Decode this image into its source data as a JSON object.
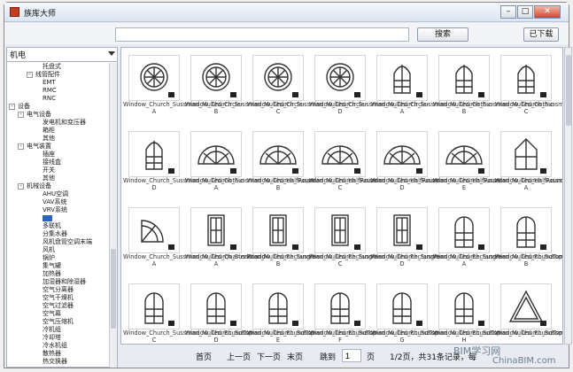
{
  "window": {
    "title": "族库大师"
  },
  "toolbar": {
    "search_value": "",
    "search_button": "搜索",
    "download_button": "已下载"
  },
  "category_combo": {
    "value": "机电"
  },
  "tree": [
    {
      "label": "托盘式",
      "level": 3,
      "toggle": ""
    },
    {
      "label": "线管配件",
      "level": 2,
      "toggle": "-"
    },
    {
      "label": "EMT",
      "level": 3,
      "toggle": ""
    },
    {
      "label": "RMC",
      "level": 3,
      "toggle": ""
    },
    {
      "label": "RNC",
      "level": 3,
      "toggle": ""
    },
    {
      "label": "设备",
      "level": 0,
      "toggle": "-"
    },
    {
      "label": "电气设备",
      "level": 1,
      "toggle": "-"
    },
    {
      "label": "发电机和变压器",
      "level": 3,
      "toggle": ""
    },
    {
      "label": "箱柜",
      "level": 3,
      "toggle": ""
    },
    {
      "label": "其他",
      "level": 3,
      "toggle": ""
    },
    {
      "label": "电气装置",
      "level": 1,
      "toggle": "-"
    },
    {
      "label": "插座",
      "level": 3,
      "toggle": ""
    },
    {
      "label": "接线盒",
      "level": 3,
      "toggle": ""
    },
    {
      "label": "开关",
      "level": 3,
      "toggle": ""
    },
    {
      "label": "其他",
      "level": 3,
      "toggle": ""
    },
    {
      "label": "机械设备",
      "level": 1,
      "toggle": "-"
    },
    {
      "label": "AHU空调",
      "level": 3,
      "toggle": ""
    },
    {
      "label": "VAV系统",
      "level": 3,
      "toggle": ""
    },
    {
      "label": "VRV系统",
      "level": 3,
      "toggle": ""
    },
    {
      "label": "",
      "level": 3,
      "toggle": "",
      "selected": true
    },
    {
      "label": "多联机",
      "level": 3,
      "toggle": ""
    },
    {
      "label": "分集水器",
      "level": 3,
      "toggle": ""
    },
    {
      "label": "风机盘管空调末端",
      "level": 3,
      "toggle": ""
    },
    {
      "label": "风机",
      "level": 3,
      "toggle": ""
    },
    {
      "label": "锅炉",
      "level": 3,
      "toggle": ""
    },
    {
      "label": "集气罐",
      "level": 3,
      "toggle": ""
    },
    {
      "label": "加热器",
      "level": 3,
      "toggle": ""
    },
    {
      "label": "加湿器和除湿器",
      "level": 3,
      "toggle": ""
    },
    {
      "label": "空气分离器",
      "level": 3,
      "toggle": ""
    },
    {
      "label": "空气干燥机",
      "level": 3,
      "toggle": ""
    },
    {
      "label": "空气过滤器",
      "level": 3,
      "toggle": ""
    },
    {
      "label": "空气幕",
      "level": 3,
      "toggle": ""
    },
    {
      "label": "空气压缩机",
      "level": 3,
      "toggle": ""
    },
    {
      "label": "冷机组",
      "level": 3,
      "toggle": ""
    },
    {
      "label": "冷却塔",
      "level": 3,
      "toggle": ""
    },
    {
      "label": "冷水机组",
      "level": 3,
      "toggle": ""
    },
    {
      "label": "散热器",
      "level": 3,
      "toggle": ""
    },
    {
      "label": "热交换器",
      "level": 3,
      "toggle": ""
    }
  ],
  "families": [
    {
      "name": "Window_Church_Sussman_Mulled_Circle-A",
      "icon": "circle-window-icon"
    },
    {
      "name": "Window_Church_Sussman_Mulled_Circle-B",
      "icon": "circle-window-icon"
    },
    {
      "name": "Window_Church_Sussman_Mulled_Circle-C",
      "icon": "circle-window-icon"
    },
    {
      "name": "Window_Church_Sussman_Mulled_Circle-D",
      "icon": "circle-window-icon"
    },
    {
      "name": "Window_Church_Sussman_Mulled_Gothic-A",
      "icon": "gothic-window-icon"
    },
    {
      "name": "Window_Church_Sussman_Mulled_Gothic-B",
      "icon": "gothic-window-icon"
    },
    {
      "name": "Window_Church_Sussman_Mulled_Gothic-C",
      "icon": "gothic-window-icon"
    },
    {
      "name": "Window_Church_Sussman_Mulled_Gothic-D",
      "icon": "gothic-window-icon"
    },
    {
      "name": "Window_Church_Sussman_Mulled_HalfRound-A",
      "icon": "halfround-window-icon"
    },
    {
      "name": "Window_Church_Sussman_Mulled_HalfRound-B",
      "icon": "halfround-window-icon"
    },
    {
      "name": "Window_Church_Sussman_Mulled_HalfRound-C",
      "icon": "halfround-window-icon"
    },
    {
      "name": "Window_Church_Sussman_Mulled_HalfRound-D",
      "icon": "halfround-window-icon"
    },
    {
      "name": "Window_Church_Sussman_Mulled_HalfRound-E",
      "icon": "halfround-window-icon"
    },
    {
      "name": "Window_Church_Sussman_Mulled_Peak-A",
      "icon": "peak-window-icon"
    },
    {
      "name": "Window_Church_Sussman_Mulled_QuarterRound-A",
      "icon": "quarterround-window-icon"
    },
    {
      "name": "Window_Church_Sussman_Mulled_Rectangle-A",
      "icon": "rectangle-window-icon"
    },
    {
      "name": "Window_Church_Sussman_Mulled_Rectangle-B",
      "icon": "rectangle-window-icon"
    },
    {
      "name": "Window_Church_Sussman_Mulled_Rectangle-C",
      "icon": "rectangle-window-icon"
    },
    {
      "name": "Window_Church_Sussman_Mulled_Rectangle-D",
      "icon": "rectangle-window-icon"
    },
    {
      "name": "Window_Church_Sussman_Mulled_RoundTop-A",
      "icon": "roundtop-window-icon"
    },
    {
      "name": "Window_Church_Sussman_Mulled_RoundTop-B",
      "icon": "roundtop-window-icon"
    },
    {
      "name": "Window_Church_Sussman_Mulled_RoundTop-C",
      "icon": "roundtop-window-icon"
    },
    {
      "name": "Window_Church_Sussman_Mulled_RoundTop-D",
      "icon": "roundtop-window-icon"
    },
    {
      "name": "Window_Church_Sussman_Mulled_RoundTop-E",
      "icon": "roundtop-window-icon"
    },
    {
      "name": "Window_Church_Sussman_Mulled_RoundTop-F",
      "icon": "roundtop-window-icon"
    },
    {
      "name": "Window_Church_Sussman_Mulled_RoundTop-G",
      "icon": "roundtop-window-icon"
    },
    {
      "name": "Window_Church_Sussman_Mulled_RoundTop-H",
      "icon": "roundtop-window-icon"
    },
    {
      "name": "Window_Church_Sussman_Trian",
      "icon": "triangle-window-icon"
    }
  ],
  "pager": {
    "first": "首页",
    "prev": "上一页",
    "next": "下一页",
    "last": "末页",
    "jump": "跳到",
    "page_value": "1",
    "page_unit": "页",
    "summary": "1/2页，共31条记录，每"
  },
  "watermark": {
    "line1": "BIM学习网",
    "line2": "ChinaBIM.com"
  },
  "colors": {
    "selection": "#2d61c7",
    "window_bg": "#e8ecf2",
    "accent_icon": "#c23b22"
  }
}
